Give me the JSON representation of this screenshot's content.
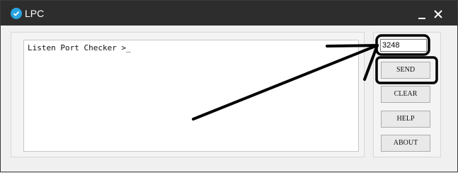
{
  "window": {
    "title": "LPC",
    "icon": "checkmark-circle-icon",
    "controls": {
      "minimize": "minimize-icon",
      "close": "close-icon"
    }
  },
  "output": {
    "text": "Listen Port Checker >_"
  },
  "port_input": {
    "value": "3248"
  },
  "buttons": {
    "send": "SEND",
    "clear": "CLEAR",
    "help": "HELP",
    "about": "ABOUT"
  },
  "colors": {
    "titlebar": "#2d2d2d",
    "icon_accent": "#29a3e0",
    "window_bg": "#f0f0f0",
    "annotation": "#000000"
  }
}
